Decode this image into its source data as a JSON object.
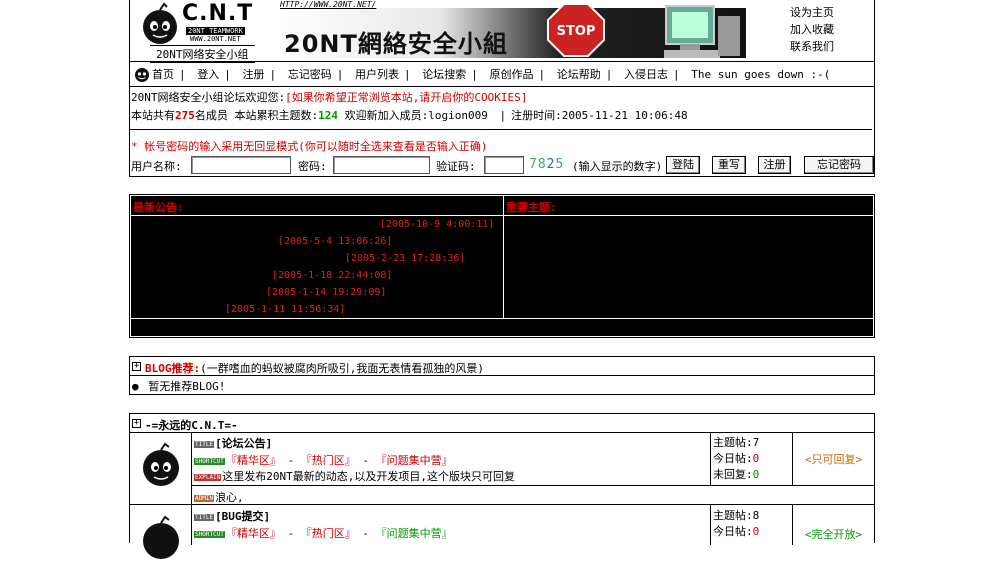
{
  "header": {
    "logo_text": "C.N.T",
    "logo_sub1": "20NT TEAMWORK",
    "logo_sub2": "WWW.20NT.NET",
    "logo_caption": "20NT网络安全小组",
    "banner_url": "HTTP://WWW.20NT.NET/",
    "banner_title": "20NT網絡安全小組",
    "banner_stop": "STOP",
    "links": [
      "设为主页",
      "加入收藏",
      "联系我们"
    ]
  },
  "nav": {
    "items": [
      "首页",
      "登入",
      "注册",
      "忘记密码",
      "用户列表",
      "论坛搜索",
      "原创作品",
      "论坛帮助",
      "入侵日志"
    ],
    "motto": "The sun goes down :-("
  },
  "welcome": {
    "prefix": "20NT网络安全小组论坛欢迎您:",
    "cookie_note": "[如果你希望正常浏览本站,请开启你的COOKIES]"
  },
  "stats": {
    "members_prefix": "本站共有",
    "members_count": "275",
    "members_suffix": "名成员",
    "topics_prefix": "本站累积主题数:",
    "topics_count": "124",
    "new_member_label": "欢迎新加入成员:",
    "new_member": "logion009",
    "reg_time": "注册时间:2005-11-21 10:06:48"
  },
  "login": {
    "hint": "* 帐号密码的输入采用无回显模式(你可以随时全选来查看是否输入正确)",
    "username_label": "用户名称:",
    "password_label": "密码:",
    "captcha_label": "验证码:",
    "captcha_digits": [
      "7",
      "8",
      "2",
      "5"
    ],
    "captcha_hint": "(输入显示的数字)",
    "btn_login": "登陆",
    "btn_reset": "重写",
    "btn_register": "注册",
    "btn_forgot": "忘记密码"
  },
  "announce": {
    "left_title": "最新公告:",
    "right_title": "重要主题:",
    "dates": [
      "[2005-10-9 4:00:11]",
      "[2005-5-4 13:06:26]",
      "[2005-2-23 17:28:36]",
      "[2005-1-18 22:44:08]",
      "[2005-1-14 19:29:09]",
      "[2005-1-11 11:56:34]"
    ]
  },
  "blog": {
    "title": "BLOG推荐:",
    "desc": "(一群嗜血的蚂蚁被腐肉所吸引,我面无表情看孤独的风景)",
    "empty": "暂无推荐BLOG!"
  },
  "forum": {
    "category_title": "-=永远的C.N.T=-",
    "tags": {
      "title": "TITLE",
      "shortcut": "SHORTCUT",
      "explain": "EXPLAIN",
      "admin": "ADMIN"
    },
    "boards": [
      {
        "title": "[论坛公告]",
        "links": [
          "『精华区』",
          "『热门区』",
          "『问题集中营』"
        ],
        "explain": "这里发布20NT最新的动态,以及开发项目,这个版块只可回复",
        "admin": "浪心,",
        "topics": "主题帖:7",
        "today_label": "今日帖:",
        "today": "0",
        "unreplied_label": "未回复:",
        "unreplied": "0",
        "status": "<只可回复>"
      },
      {
        "title": "[BUG提交]",
        "links": [
          "『精华区』",
          "『热门区』",
          "『问题集中营』"
        ],
        "topics": "主题帖:8",
        "today_label": "今日帖:",
        "today": "0",
        "status": "<完全开放>"
      }
    ]
  },
  "colors": {
    "accent_red": "#cc0000",
    "panel_bg": "#000000",
    "green": "#009900",
    "orange": "#cc6600"
  }
}
